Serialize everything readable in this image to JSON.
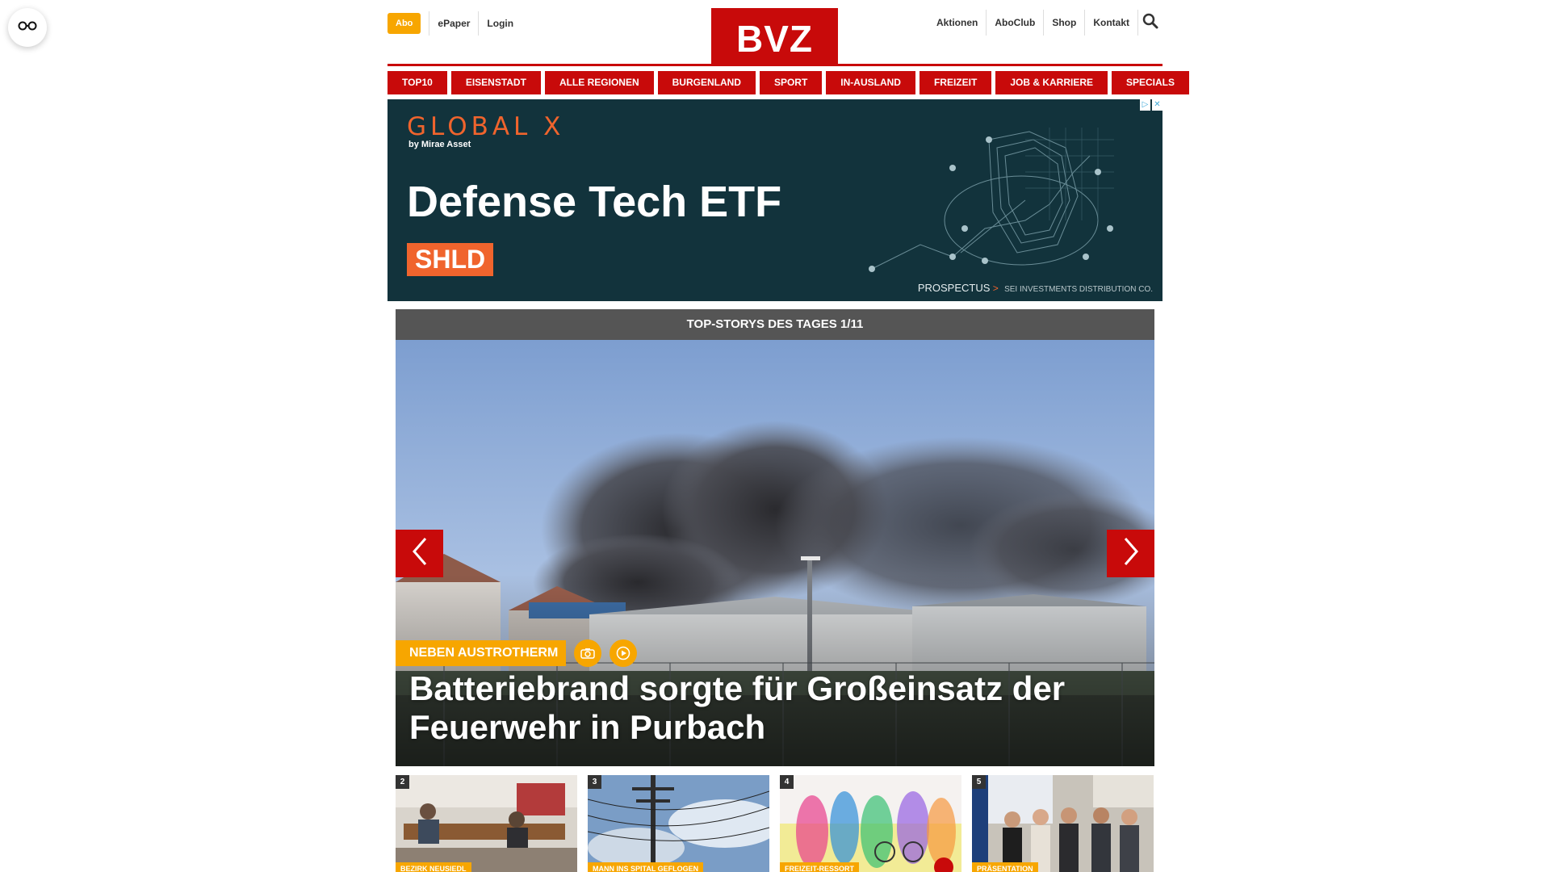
{
  "header": {
    "abo_label": "Abo",
    "left_links": [
      "ePaper",
      "Login"
    ],
    "logo_text": "BVZ",
    "right_links": [
      "Aktionen",
      "AboClub",
      "Shop",
      "Kontakt"
    ],
    "search_icon": "search-icon"
  },
  "nav": {
    "items": [
      "TOP10",
      "EISENSTADT",
      "ALLE REGIONEN",
      "BURGENLAND",
      "SPORT",
      "IN-AUSLAND",
      "FREIZEIT",
      "JOB & KARRIERE",
      "SPECIALS"
    ]
  },
  "ad": {
    "brand": "GLOBAL X",
    "brand_sub": "by Mirae Asset",
    "headline": "Defense Tech ETF",
    "ticker": "SHLD",
    "prospectus": "PROSPECTUS",
    "prospectus_arrow": ">",
    "distributor": "SEI INVESTMENTS DISTRIBUTION CO.",
    "colors": {
      "background": "#12333c",
      "accent": "#f0642d"
    }
  },
  "stories": {
    "header": "TOP-STORYS DES TAGES 1/11",
    "hero": {
      "kicker": "NEBEN AUSTROTHERM",
      "title": "Batteriebrand sorgte für Großeinsatz der Feuerwehr in Purbach",
      "icons": [
        "camera-icon",
        "play-icon"
      ]
    },
    "thumbs": [
      {
        "number": "2",
        "label": "BEZIRK NEUSIEDL"
      },
      {
        "number": "3",
        "label": "MANN INS SPITAL GEFLOGEN"
      },
      {
        "number": "4",
        "label": "FREIZEIT-RESSORT"
      },
      {
        "number": "5",
        "label": "PRÄSENTATION"
      }
    ]
  },
  "colors": {
    "brand_red": "#c80a0a",
    "accent_orange": "#f7a600",
    "story_header": "#555555"
  }
}
